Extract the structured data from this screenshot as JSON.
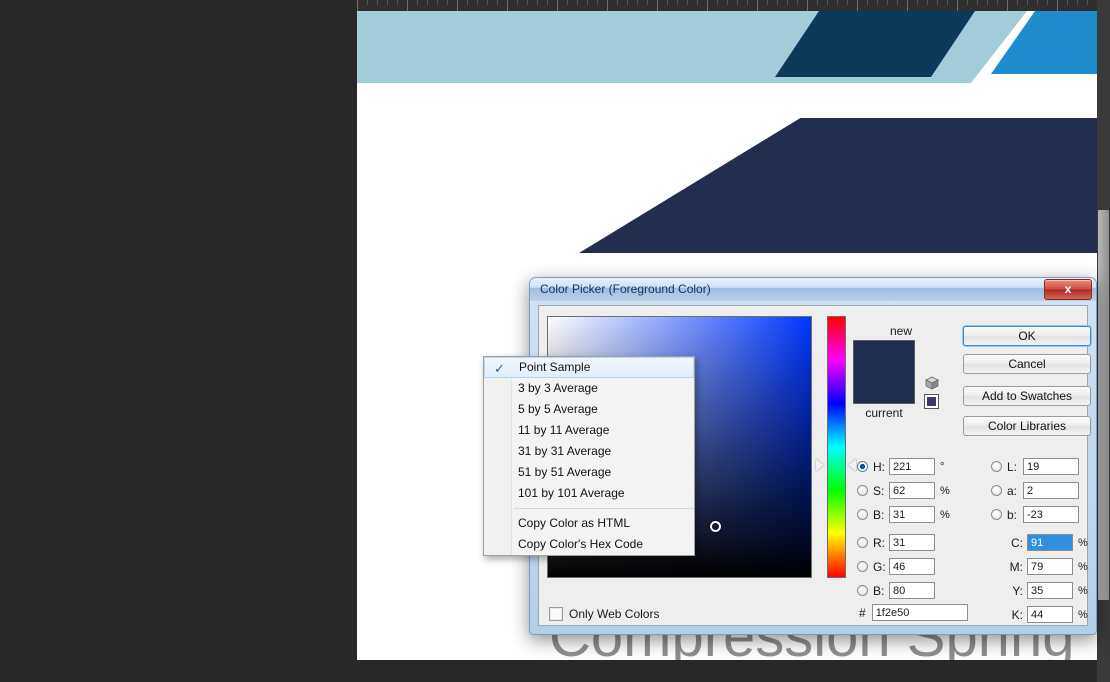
{
  "workspace": {
    "canvas_heading": "Compression  Spring",
    "shapes": [
      {
        "name": "teal-band",
        "color": "#a2cdd8"
      },
      {
        "name": "dark-teal-parallelogram",
        "color": "#0c3a5a"
      },
      {
        "name": "bright-blue-parallelogram",
        "color": "#1f8ccd"
      },
      {
        "name": "navy-block",
        "color": "#232d4f"
      }
    ]
  },
  "dialog": {
    "title": "Color Picker (Foreground Color)",
    "close_label": "x",
    "swatch": {
      "new_label": "new",
      "current_label": "current",
      "new_color": "#1f2e50",
      "current_color": "#1f2e50"
    },
    "buttons": {
      "ok": "OK",
      "cancel": "Cancel",
      "add_to_swatches": "Add to Swatches",
      "color_libraries": "Color Libraries"
    },
    "only_web_colors": {
      "label": "Only Web Colors",
      "checked": false
    },
    "hex": {
      "symbol": "#",
      "value": "1f2e50"
    },
    "fields": {
      "hsb": [
        {
          "name": "hue",
          "label": "H:",
          "value": "221",
          "unit": "°",
          "selected": true
        },
        {
          "name": "saturation",
          "label": "S:",
          "value": "62",
          "unit": "%",
          "selected": false
        },
        {
          "name": "brightness",
          "label": "B:",
          "value": "31",
          "unit": "%",
          "selected": false
        }
      ],
      "rgb": [
        {
          "name": "red",
          "label": "R:",
          "value": "31",
          "unit": "",
          "selected": false
        },
        {
          "name": "green",
          "label": "G:",
          "value": "46",
          "unit": "",
          "selected": false
        },
        {
          "name": "blue",
          "label": "B:",
          "value": "80",
          "unit": "",
          "selected": false
        }
      ],
      "lab": [
        {
          "name": "lightness",
          "label": "L:",
          "value": "19",
          "unit": "",
          "selected": false
        },
        {
          "name": "a",
          "label": "a:",
          "value": "2",
          "unit": "",
          "selected": false
        },
        {
          "name": "b",
          "label": "b:",
          "value": "-23",
          "unit": "",
          "selected": false
        }
      ],
      "cmyk": [
        {
          "name": "cyan",
          "label": "C:",
          "value": "91",
          "unit": "%",
          "highlighted": true
        },
        {
          "name": "magenta",
          "label": "M:",
          "value": "79",
          "unit": "%",
          "highlighted": false
        },
        {
          "name": "yellow",
          "label": "Y:",
          "value": "35",
          "unit": "%",
          "highlighted": false
        },
        {
          "name": "black",
          "label": "K:",
          "value": "44",
          "unit": "%",
          "highlighted": false
        }
      ]
    }
  },
  "sample_size_menu": {
    "items": [
      {
        "label": "Point Sample",
        "checked": true
      },
      {
        "label": "3 by 3 Average",
        "checked": false
      },
      {
        "label": "5 by 5 Average",
        "checked": false
      },
      {
        "label": "11 by 11 Average",
        "checked": false
      },
      {
        "label": "31 by 31 Average",
        "checked": false
      },
      {
        "label": "51 by 51 Average",
        "checked": false
      },
      {
        "label": "101 by 101 Average",
        "checked": false
      }
    ],
    "copy_items": [
      {
        "label": "Copy Color as HTML"
      },
      {
        "label": "Copy Color's Hex Code"
      }
    ],
    "check_glyph": "✓"
  }
}
